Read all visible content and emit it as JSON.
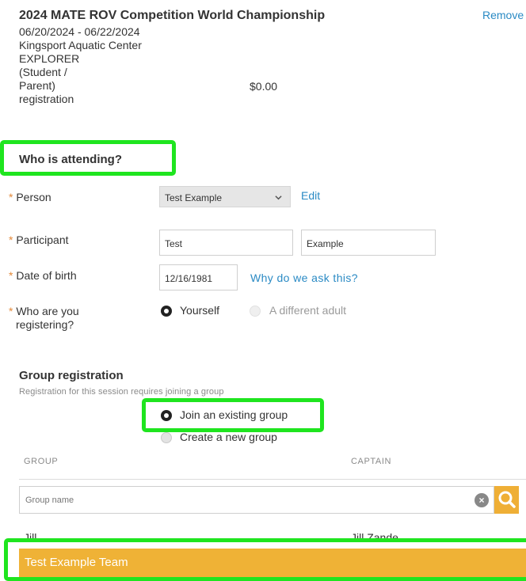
{
  "event": {
    "title": "2024 MATE ROV Competition World Championship",
    "remove_label": "Remove",
    "dates": "06/20/2024 - 06/22/2024",
    "location": "Kingsport Aquatic Center",
    "registration_lines": [
      "EXPLORER",
      "(Student /",
      "Parent)",
      "registration"
    ],
    "price": "$0.00"
  },
  "attending": {
    "heading": "Who is attending?",
    "required_marker": "*",
    "person": {
      "label": "Person",
      "selected": "Test Example",
      "edit_label": "Edit"
    },
    "participant": {
      "label": "Participant",
      "first_name": "Test",
      "last_name": "Example"
    },
    "dob": {
      "label": "Date of birth",
      "value": "12/16/1981",
      "why_label": "Why do we ask this?"
    },
    "registering": {
      "label_lines": [
        "Who are you",
        "registering?"
      ],
      "options": [
        {
          "label": "Yourself",
          "selected": true
        },
        {
          "label": "A different adult",
          "selected": false
        }
      ]
    }
  },
  "group": {
    "heading": "Group registration",
    "note": "Registration for this session requires joining a group",
    "options": [
      {
        "label": "Join an existing group",
        "selected": true
      },
      {
        "label": "Create a new group",
        "selected": false
      }
    ],
    "columns": {
      "group": "GROUP",
      "captain": "CAPTAIN"
    },
    "search_placeholder": "Group name",
    "rows": [
      {
        "group": "Jill",
        "captain": "Jill Zande"
      }
    ],
    "selected_row": "Test Example Team"
  },
  "colors": {
    "link": "#2a8ac4",
    "required": "#e3893a",
    "accent": "#efb236",
    "highlight": "#1fe51f"
  },
  "icons": {
    "select_arrow": "chevron-down-icon",
    "clear": "clear-icon",
    "search": "search-icon"
  }
}
